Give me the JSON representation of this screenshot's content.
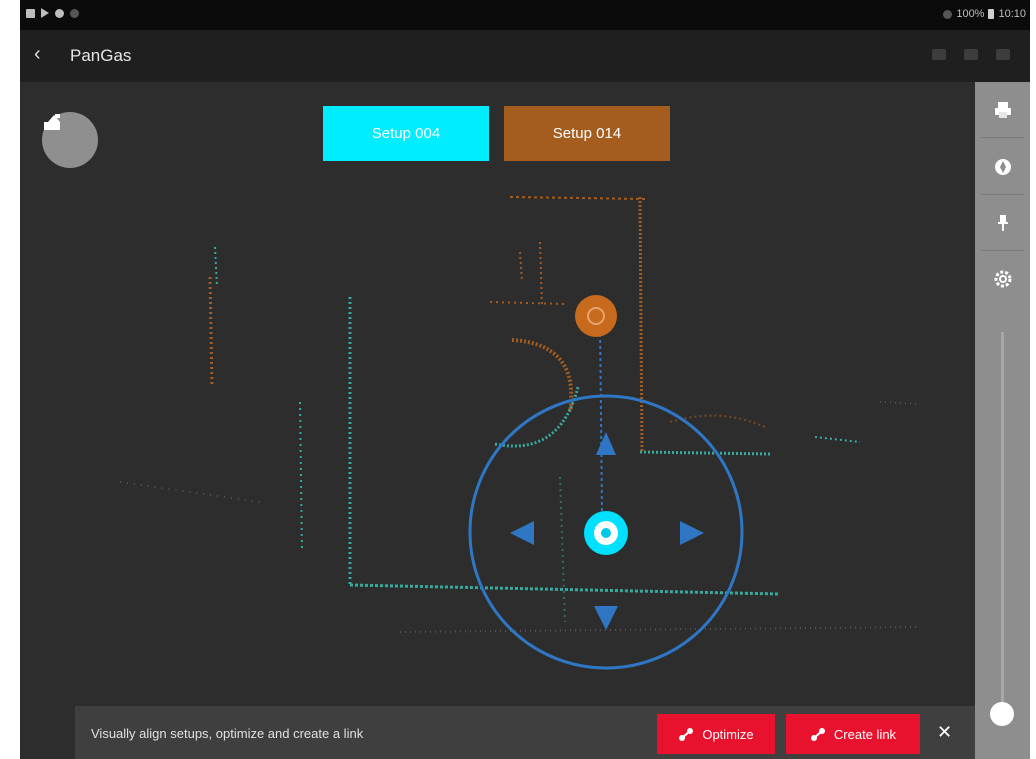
{
  "status_bar": {
    "battery_text": "100%",
    "time": "10:10",
    "icons": [
      "gallery-icon",
      "play-store-icon",
      "settings-dot-icon",
      "wifi-icon",
      "battery-icon"
    ]
  },
  "app_bar": {
    "title": "PanGas",
    "back_icon": "chevron-left-icon",
    "actions": [
      "link-icon",
      "camera-icon",
      "device-icon"
    ]
  },
  "viewer": {
    "fab_icon": "scanner-icon",
    "setup_a_label": "Setup 004",
    "setup_b_label": "Setup 014",
    "setup_a_color": "#00ecff",
    "setup_b_color": "#a55c1f",
    "pointcloud_colors": {
      "setup_a": "#39c0b4",
      "setup_b": "#b8651e"
    },
    "joystick_color": "#2f77c4"
  },
  "right_panel": {
    "tools": [
      "print-icon",
      "compass-icon",
      "pin-icon",
      "settings-icon"
    ]
  },
  "bottom_bar": {
    "hint": "Visually align setups, optimize and create a link",
    "optimize_label": "Optimize",
    "create_link_label": "Create link",
    "close_label": "✕",
    "accent_color": "#e8122e"
  }
}
